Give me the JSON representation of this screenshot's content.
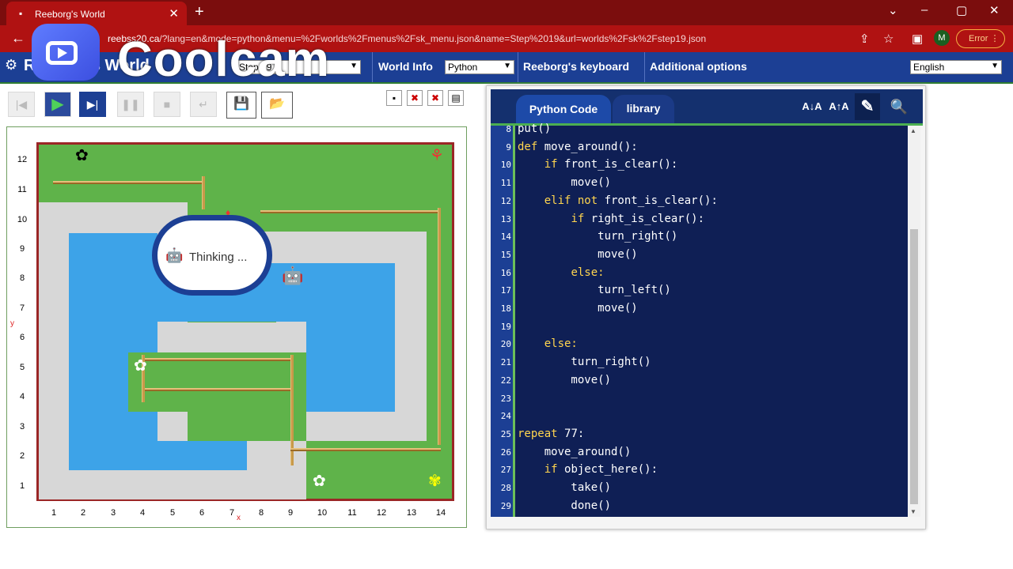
{
  "browser": {
    "tab_title": "Reeborg's World",
    "new_tab": "+",
    "url_host": "reeborg.ca",
    "url_host_visible": "reeb",
    "url_host_tail": "ss20.ca",
    "url_path": "/?lang=en&mode=python&menu=%2Fworlds%2Fmenus%2Fsk_menu.json&name=Step%2019&url=worlds%2Fsk%2Fstep19.json",
    "profile_initial": "M",
    "error_label": "Error",
    "back_icon": "arrow-left",
    "min": "–",
    "max": "▢",
    "close": "✕",
    "menu_dots": "⋮"
  },
  "app": {
    "title": "Reeborg's World",
    "world_select": "Step 19",
    "world_info": "World Info",
    "language_select": "Python",
    "keyboard": "Reeborg's keyboard",
    "options": "Additional options",
    "ui_language": "English"
  },
  "watermark": {
    "text": "Coolcam"
  },
  "controls": {
    "play": "▶",
    "step": "▶|",
    "pause": "❚❚",
    "stop": "■",
    "reload": "↵",
    "back": "|◀"
  },
  "world": {
    "y_labels": [
      "12",
      "11",
      "10",
      "9",
      "8",
      "7",
      "6",
      "5",
      "4",
      "3",
      "2",
      "1"
    ],
    "x_labels": [
      "1",
      "2",
      "3",
      "4",
      "5",
      "6",
      "7",
      "8",
      "9",
      "10",
      "11",
      "12",
      "13",
      "14"
    ],
    "x_axis": "x",
    "y_axis": "y",
    "thinking": "Thinking ...",
    "robot_icon": "robot-icon",
    "flower_icon": "daisy-icon",
    "tulip_icon": "tulip-icon"
  },
  "editor": {
    "tab_code": "Python Code",
    "tab_library": "library",
    "font_smaller": "A↓A",
    "font_larger": "A↑A",
    "lines": [
      {
        "n": "8",
        "t": "put()"
      },
      {
        "n": "9",
        "t": "def move_around():"
      },
      {
        "n": "10",
        "t": "    if front_is_clear():"
      },
      {
        "n": "11",
        "t": "        move()"
      },
      {
        "n": "12",
        "t": "    elif not front_is_clear():"
      },
      {
        "n": "13",
        "t": "        if right_is_clear():"
      },
      {
        "n": "14",
        "t": "            turn_right()"
      },
      {
        "n": "15",
        "t": "            move()"
      },
      {
        "n": "16",
        "t": "        else:"
      },
      {
        "n": "17",
        "t": "            turn_left()"
      },
      {
        "n": "18",
        "t": "            move()"
      },
      {
        "n": "19",
        "t": ""
      },
      {
        "n": "20",
        "t": "    else:"
      },
      {
        "n": "21",
        "t": "        turn_right()"
      },
      {
        "n": "22",
        "t": "        move()"
      },
      {
        "n": "23",
        "t": ""
      },
      {
        "n": "24",
        "t": ""
      },
      {
        "n": "25",
        "t": "repeat 77:"
      },
      {
        "n": "26",
        "t": "    move_around()"
      },
      {
        "n": "27",
        "t": "    if object_here():"
      },
      {
        "n": "28",
        "t": "        take()"
      },
      {
        "n": "29",
        "t": "        done()"
      }
    ]
  }
}
